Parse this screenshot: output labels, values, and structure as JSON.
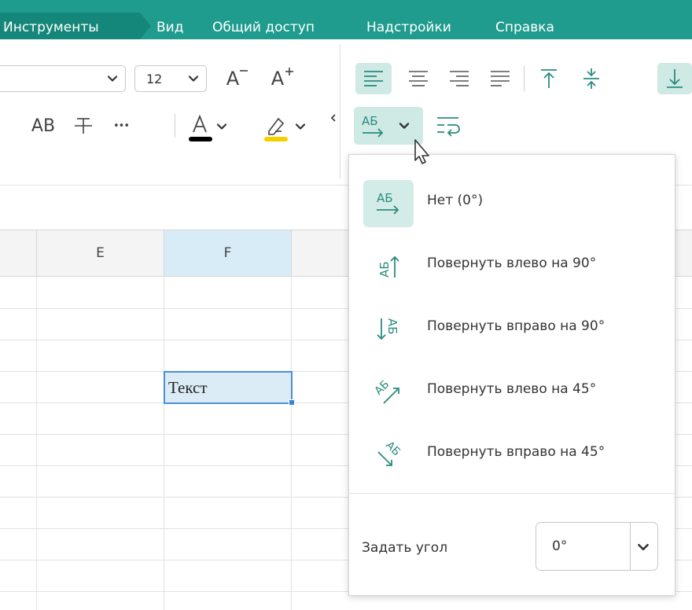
{
  "menubar": {
    "items": [
      "Инструменты",
      "Вид",
      "Общий доступ",
      "Надстройки",
      "Справка"
    ],
    "bg_color": "#1f9c8e"
  },
  "ribbon": {
    "font_size_value": "12",
    "increase_font_label": "A",
    "decrease_font_label": "A",
    "case_label": "AB",
    "more_label": "•••",
    "font_color": "#000000",
    "highlight_color": "#f5d000",
    "rotation_button_label": "АБ"
  },
  "sheet": {
    "columns": [
      "E",
      "F"
    ],
    "active_column": "F",
    "selected_cell_text": "Текст"
  },
  "rotation_menu": {
    "options": [
      {
        "label": "Нет (0°)",
        "icon": "text-no-rotation-icon",
        "active": true
      },
      {
        "label": "Повернуть влево на 90°",
        "icon": "text-rotate-left-90-icon",
        "active": false
      },
      {
        "label": "Повернуть вправо на 90°",
        "icon": "text-rotate-right-90-icon",
        "active": false
      },
      {
        "label": "Повернуть влево на 45°",
        "icon": "text-rotate-left-45-icon",
        "active": false
      },
      {
        "label": "Повернуть вправо на 45°",
        "icon": "text-rotate-right-45-icon",
        "active": false
      }
    ],
    "angle_label": "Задать угол",
    "angle_value": "0°",
    "accent_color": "#1f9c8e"
  }
}
